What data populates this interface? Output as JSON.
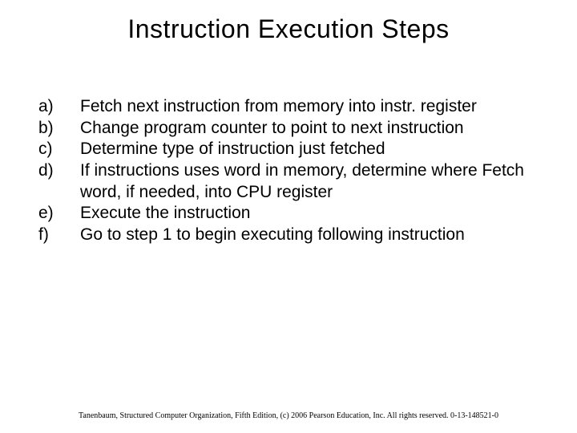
{
  "title": "Instruction Execution Steps",
  "items": [
    {
      "letter": "a)",
      "text": "Fetch next instruction from memory into instr. register"
    },
    {
      "letter": "b)",
      "text": "Change program counter to point to next instruction"
    },
    {
      "letter": "c)",
      "text": "Determine type of instruction just fetched"
    },
    {
      "letter": "d)",
      "text": "If instructions uses word in memory, determine where Fetch word, if needed, into CPU register"
    },
    {
      "letter": "e)",
      "text": "Execute the instruction"
    },
    {
      "letter": "f)",
      "text": "Go to step 1 to begin executing following instruction"
    }
  ],
  "footer": "Tanenbaum, Structured Computer Organization, Fifth Edition, (c) 2006 Pearson Education, Inc. All rights reserved. 0-13-148521-0"
}
